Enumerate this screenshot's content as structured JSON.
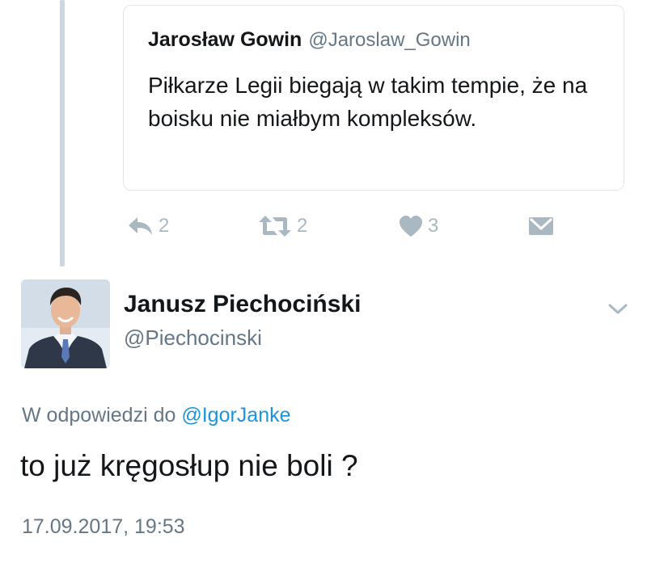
{
  "quoted_tweet": {
    "author_name": "Jarosław Gowin",
    "author_handle": "@Jaroslaw_Gowin",
    "text": "Piłkarze Legii biegają w takim tempie, że na boisku nie miałbym kompleksów."
  },
  "actions": {
    "reply_count": "2",
    "retweet_count": "2",
    "like_count": "3"
  },
  "tweet": {
    "author_name": "Janusz Piechociński",
    "author_handle": "@Piechocinski",
    "reply_prefix": "W odpowiedzi do",
    "reply_to_handle": "@IgorJanke",
    "text": "to już kręgosłup nie boli ?",
    "timestamp": "17.09.2017, 19:53"
  },
  "colors": {
    "link": "#1b95e0",
    "secondary_text": "#657786",
    "action_icon": "#aab8c2",
    "border": "#e1e8ed",
    "thread_line": "#ccd6dd"
  },
  "icons": [
    "reply-icon",
    "retweet-icon",
    "heart-icon",
    "direct-message-icon",
    "chevron-down-icon"
  ]
}
